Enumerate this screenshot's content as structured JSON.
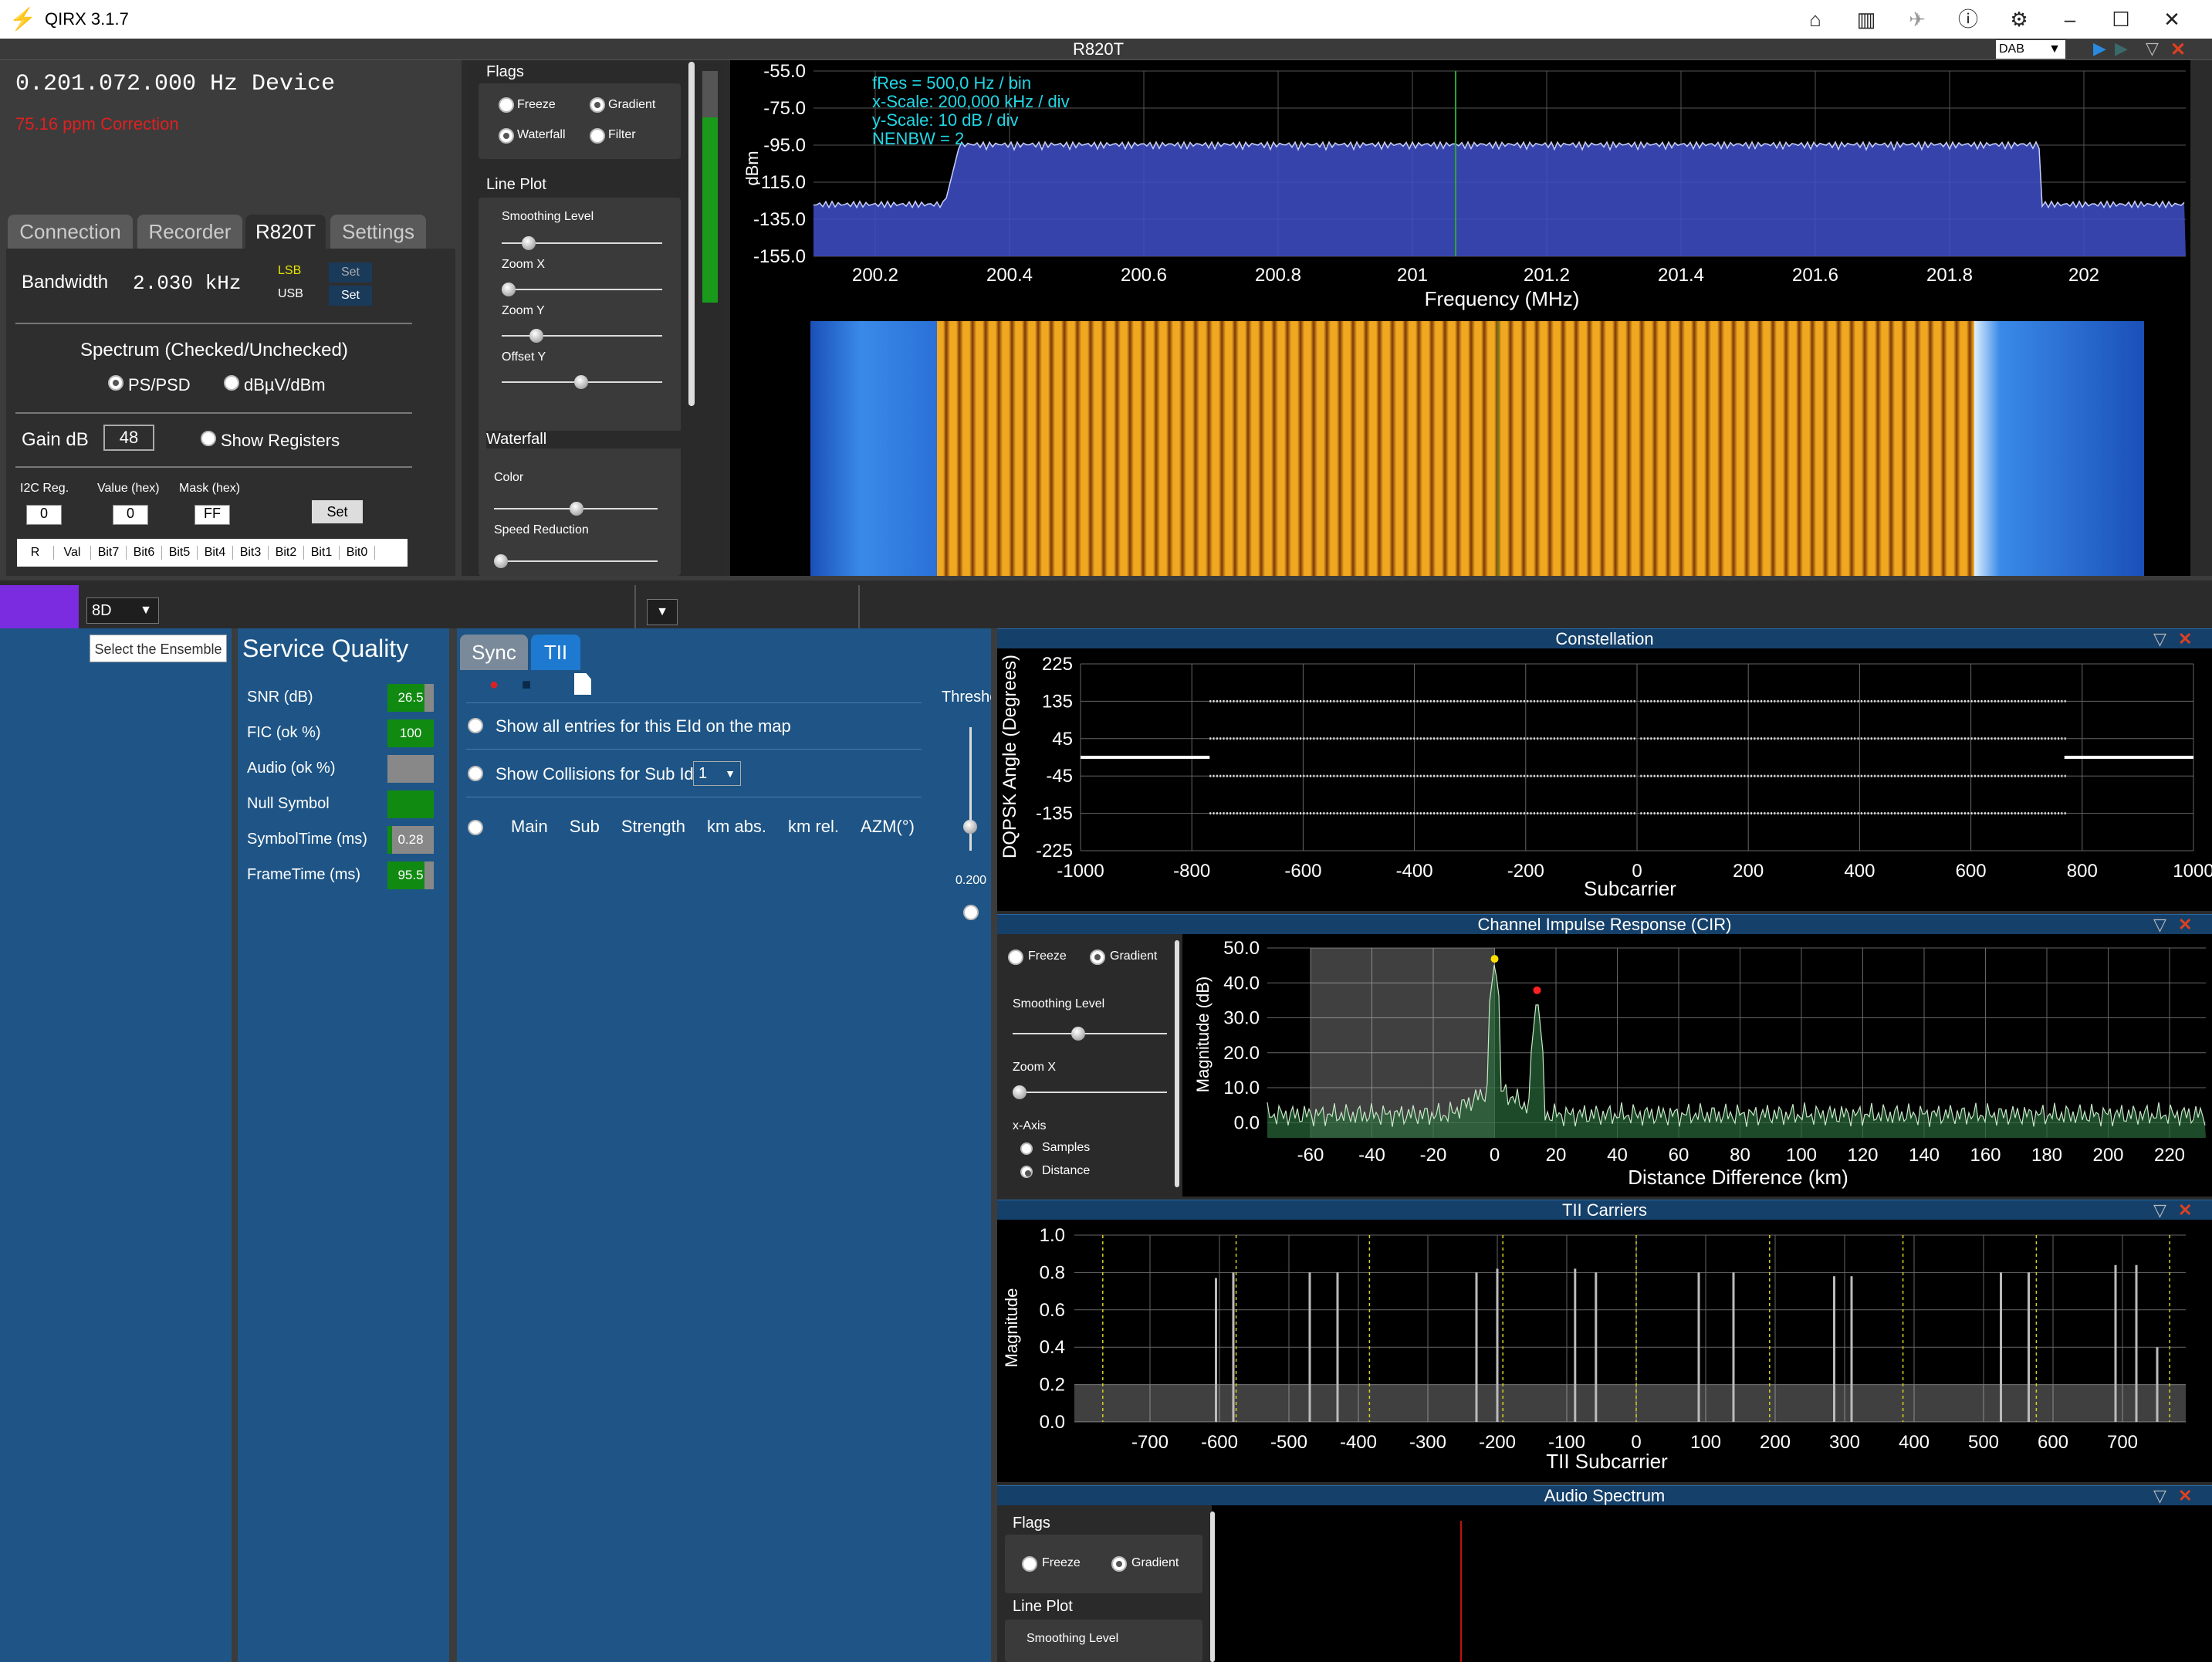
{
  "window": {
    "title": "QIRX 3.1.7"
  },
  "device_panel": {
    "header": "R820T",
    "mode_select": "DAB",
    "frequency": "0.201.072.000 Hz Device",
    "correction": "75.16 ppm Correction",
    "tabs": [
      "Connection",
      "Recorder",
      "R820T",
      "Settings"
    ],
    "bandwidth_label": "Bandwidth",
    "bandwidth_value": "2.030 kHz",
    "lsb": "LSB",
    "usb": "USB",
    "set1": "Set",
    "set2": "Set",
    "spectrum_label": "Spectrum (Checked/Unchecked)",
    "ps_psd": "PS/PSD",
    "dbuv": "dBµV/dBm",
    "gain_label": "Gain dB",
    "gain_value": "48",
    "show_registers": "Show Registers",
    "i2c_reg": "I2C Reg.",
    "value_hex": "Value (hex)",
    "mask_hex": "Mask (hex)",
    "i2c_val": "0",
    "value_val": "0",
    "mask_val": "FF",
    "set3": "Set",
    "bit_columns": [
      "R",
      "Val",
      "Bit7",
      "Bit6",
      "Bit5",
      "Bit4",
      "Bit3",
      "Bit2",
      "Bit1",
      "Bit0"
    ]
  },
  "controls": {
    "flags": "Flags",
    "freeze": "Freeze",
    "gradient": "Gradient",
    "waterfall": "Waterfall",
    "filter": "Filter",
    "line_plot": "Line Plot",
    "smoothing": "Smoothing Level",
    "zoom_x": "Zoom X",
    "zoom_y": "Zoom Y",
    "offset_y": "Offset Y",
    "waterfall_hdr": "Waterfall",
    "color": "Color",
    "speed_reduction": "Speed Reduction"
  },
  "spectrum": {
    "info": [
      "fRes = 500,0 Hz / bin",
      "x-Scale: 200,000 kHz / div",
      "y-Scale: 10 dB / div",
      "NENBW = 2"
    ],
    "ylabel": "dBm",
    "xlabel": "Frequency (MHz)",
    "yticks": [
      "-55.0",
      "-75.0",
      "-95.0",
      "-115.0",
      "-135.0",
      "-155.0"
    ],
    "xticks": [
      "200.2",
      "200.4",
      "200.6",
      "200.8",
      "201",
      "201.2",
      "201.4",
      "201.6",
      "201.8",
      "202"
    ]
  },
  "ensemble": {
    "channel": "8D",
    "select_button": "Select the Ensemble"
  },
  "service_quality": {
    "title": "Service Quality",
    "rows": [
      {
        "label": "SNR (dB)",
        "value": "26.5",
        "fill": 0.8
      },
      {
        "label": "FIC (ok %)",
        "value": "100",
        "fill": 1.0
      },
      {
        "label": "Audio (ok %)",
        "value": "",
        "fill": 0.0
      },
      {
        "label": "Null Symbol",
        "value": "",
        "fill": 1.0
      },
      {
        "label": "SymbolTime (ms)",
        "value": "0.28",
        "fill": 0.1
      },
      {
        "label": "FrameTime (ms)",
        "value": "95.5",
        "fill": 0.8
      }
    ]
  },
  "tii_panel": {
    "tabs": [
      "Sync",
      "TII"
    ],
    "show_all": "Show all entries for this EId on the map",
    "show_collisions": "Show Collisions for Sub Id",
    "sub_id": "1",
    "threshold": "Thresho",
    "threshold_value": "0.200",
    "columns": [
      "Main",
      "Sub",
      "Strength",
      "km abs.",
      "km rel.",
      "AZM(°)"
    ]
  },
  "constellation": {
    "title": "Constellation",
    "ylabel": "DQPSK Angle (Degrees)",
    "xlabel": "Subcarrier",
    "yticks": [
      "225",
      "135",
      "45",
      "-45",
      "-135",
      "-225"
    ],
    "xticks": [
      "-1000",
      "-800",
      "-600",
      "-400",
      "-200",
      "0",
      "200",
      "400",
      "600",
      "800",
      "1000"
    ]
  },
  "cir": {
    "title": "Channel Impulse Response (CIR)",
    "freeze": "Freeze",
    "gradient": "Gradient",
    "smoothing": "Smoothing Level",
    "zoom_x": "Zoom X",
    "x_axis": "x-Axis",
    "samples": "Samples",
    "distance": "Distance",
    "ylabel": "Magnitude (dB)",
    "xlabel": "Distance Difference (km)",
    "yticks": [
      "50.0",
      "40.0",
      "30.0",
      "20.0",
      "10.0",
      "0.0"
    ],
    "xticks": [
      "-60",
      "-40",
      "-20",
      "0",
      "20",
      "40",
      "60",
      "80",
      "100",
      "120",
      "140",
      "160",
      "180",
      "200",
      "220"
    ]
  },
  "tii_carriers": {
    "title": "TII Carriers",
    "ylabel": "Magnitude",
    "xlabel": "TII Subcarrier",
    "yticks": [
      "1.0",
      "0.8",
      "0.6",
      "0.4",
      "0.2",
      "0.0"
    ],
    "xticks": [
      "-700",
      "-600",
      "-500",
      "-400",
      "-300",
      "-200",
      "-100",
      "0",
      "100",
      "200",
      "300",
      "400",
      "500",
      "600",
      "700"
    ]
  },
  "audio": {
    "title": "Audio Spectrum",
    "flags": "Flags",
    "freeze": "Freeze",
    "gradient": "Gradient",
    "line_plot": "Line Plot",
    "smoothing": "Smoothing Level"
  },
  "colors": {
    "accent": "#1e5586",
    "good": "#118a11",
    "spectrum_fill": "#3f4fc8",
    "waterfall_orange": "#e89a1a",
    "cyan_text": "#21d7e6"
  }
}
